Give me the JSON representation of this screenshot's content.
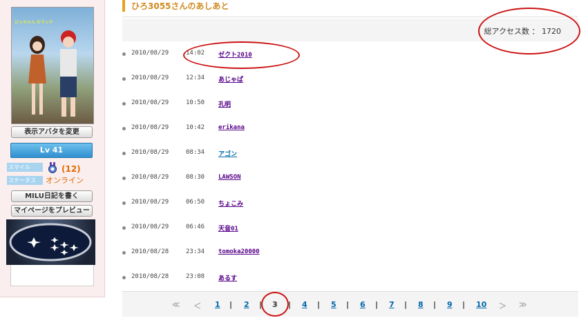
{
  "sidebar": {
    "avatar_caption": "ひっちゃん のマッチ",
    "change_avatar_label": "表示アバタを変更",
    "level_label": "Lv 41",
    "smile_tag": "スマイル",
    "smile_count": "(12)",
    "status_tag": "ステータス",
    "status_value": "オンライン",
    "diary_button": "MILU日記を書く",
    "preview_button": "マイページをプレビュー"
  },
  "main": {
    "title": "ひろ3055さんのあしあと",
    "access_label": "総アクセス数 ： 1720"
  },
  "visits": [
    {
      "date": "2010/08/29",
      "time": "14:02",
      "name": "ゼクト2010",
      "color": "#550088"
    },
    {
      "date": "2010/08/29",
      "time": "12:34",
      "name": "あじゃぱ",
      "color": "#550088"
    },
    {
      "date": "2010/08/29",
      "time": "10:50",
      "name": "孔明",
      "color": "#550088"
    },
    {
      "date": "2010/08/29",
      "time": "10:42",
      "name": "erikana",
      "color": "#550088"
    },
    {
      "date": "2010/08/29",
      "time": "08:34",
      "name": "アゴン",
      "color": "#0066aa"
    },
    {
      "date": "2010/08/29",
      "time": "08:30",
      "name": "LAWSON",
      "color": "#550088"
    },
    {
      "date": "2010/08/29",
      "time": "06:50",
      "name": "ちょこみ",
      "color": "#550088"
    },
    {
      "date": "2010/08/29",
      "time": "06:46",
      "name": "天音01",
      "color": "#550088"
    },
    {
      "date": "2010/08/28",
      "time": "23:34",
      "name": "tomoka20000",
      "color": "#550088"
    },
    {
      "date": "2010/08/28",
      "time": "23:08",
      "name": "あるす",
      "color": "#550088"
    }
  ],
  "pager": {
    "first": "≪",
    "prev": "＜",
    "pages": [
      "1",
      "2",
      "3",
      "4",
      "5",
      "6",
      "7",
      "8",
      "9",
      "10"
    ],
    "current": "3",
    "separator": "|",
    "next": "＞",
    "last": "≫"
  },
  "colors": {
    "title": "#d08a20",
    "link_visited": "#550088",
    "link": "#0066aa",
    "highlight": "#cc1111"
  }
}
